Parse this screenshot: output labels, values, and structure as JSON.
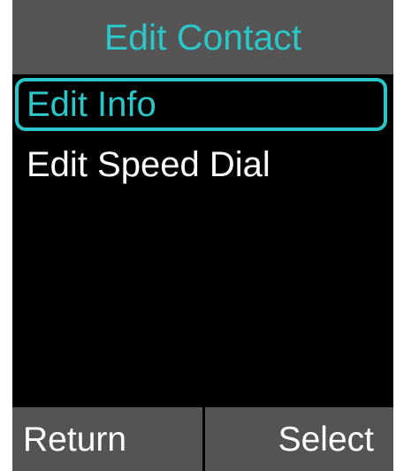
{
  "header": {
    "title": "Edit Contact"
  },
  "menu": {
    "items": [
      {
        "label": "Edit Info",
        "selected": true
      },
      {
        "label": "Edit Speed Dial",
        "selected": false
      }
    ]
  },
  "softkeys": {
    "left_label": "Return",
    "right_label": "Select"
  },
  "colors": {
    "accent": "#2ac6c8",
    "bar_background": "#555555",
    "screen_background": "#000000",
    "text": "#ffffff"
  }
}
